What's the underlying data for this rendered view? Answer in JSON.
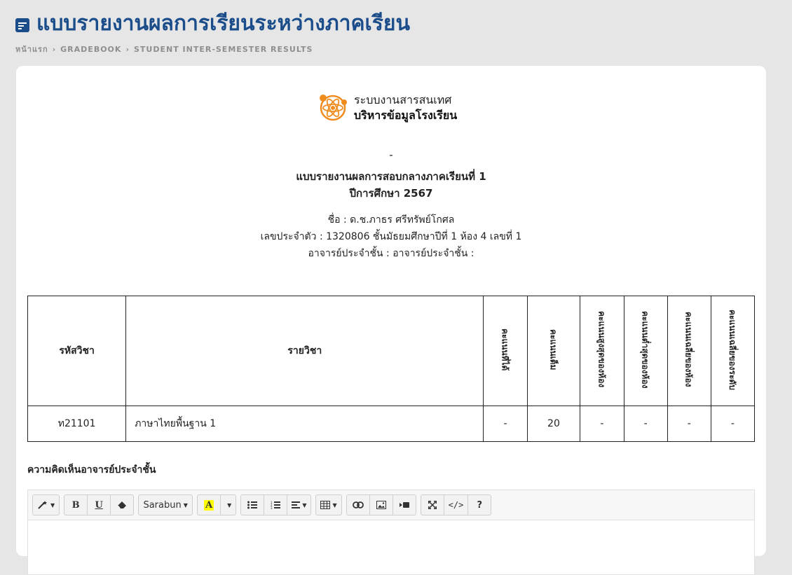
{
  "page": {
    "title": "แบบรายงานผลการเรียนระหว่างภาคเรียน",
    "title_icon": "note-icon",
    "breadcrumb": [
      "หน้าแรก",
      "GRADEBOOK",
      "STUDENT INTER-SEMESTER RESULTS"
    ],
    "accent_color": "#1a4d8a"
  },
  "logo": {
    "line1": "ระบบงานสารสนเทศ",
    "line2": "บริหารข้อมูลโรงเรียน",
    "icon": "atom-logo-icon"
  },
  "report": {
    "dash": "-",
    "title": "แบบรายงานผลการสอบกลางภาคเรียนที่ 1",
    "year": "ปีการศึกษา 2567",
    "name": "ชื่อ : ด.ช.ภาธร ศรีทรัพย์โกศล",
    "student_info": "เลขประจำตัว : 1320806 ชั้นมัธยมศึกษาปีที่ 1 ห้อง 4 เลขที่ 1",
    "teacher": "อาจารย์ประจำชั้น :      อาจารย์ประจำชั้น :"
  },
  "table": {
    "headers": {
      "code": "รหัสวิชา",
      "subject": "รายวิชา",
      "c1": "คะแนนที่ได้",
      "c2": "คะแนนเต็ม",
      "c3": "คะแนนสูงสุดของห้อง",
      "c4": "คะแนนต่ำสุดของห้อง",
      "c5": "คะแนนเฉลี่ยของห้อง",
      "c6": "คะแนนเฉลี่ยของระดับ"
    },
    "rows": [
      {
        "code": "ท21101",
        "subject": "ภาษาไทยพื้นฐาน 1",
        "c1": "-",
        "c2": "20",
        "c3": "-",
        "c4": "-",
        "c5": "-",
        "c6": "-"
      }
    ]
  },
  "comment": {
    "label": "ความคิดเห็นอาจารย์ประจำชั้น",
    "toolbar": {
      "bold": "B",
      "underline": "U",
      "font": "Sarabun",
      "color_letter": "A",
      "highlight_color": "#ffff00"
    }
  }
}
